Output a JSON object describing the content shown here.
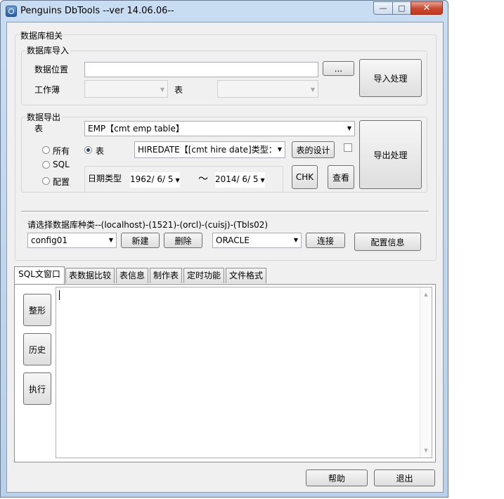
{
  "window": {
    "title": "Penguins DbTools --ver 14.06.06--",
    "min_glyph": "—",
    "max_glyph": "□",
    "close_glyph": "✕"
  },
  "db_section": {
    "title": "数据库相关",
    "import": {
      "title": "数据库导入",
      "location_label": "数据位置",
      "location_value": "",
      "browse_label": "...",
      "workbook_label": "工作薄",
      "workbook_value": "",
      "table_label": "表",
      "table_value": "",
      "import_button": "导入处理"
    },
    "export": {
      "title": "数据导出",
      "table_label": "表",
      "table_value": "EMP【cmt emp table】",
      "radio_all": "所有",
      "radio_table": "表",
      "radio_sql": "SQL",
      "radio_config": "配置",
      "column_value": "HIREDATE【[cmt hire date]类型：",
      "table_design_button": "表的设计",
      "date_type_label": "日期类型",
      "date_from": "1962/  6/  5",
      "tilde": "～",
      "date_to": "2014/  6/  5",
      "chk_button": "CHK",
      "view_button": "查看",
      "export_button": "导出处理"
    },
    "connection": {
      "label": "请选择数据库种类--(localhost)-(1521)-(orcl)-(cuisj)-(Tbls02)",
      "config_value": "config01",
      "new_button": "新建",
      "delete_button": "删除",
      "db_type_value": "ORACLE",
      "connect_button": "连接",
      "config_info_button": "配置信息"
    }
  },
  "tabs": [
    {
      "label": "SQL文窗口"
    },
    {
      "label": "表数据比较"
    },
    {
      "label": "表信息"
    },
    {
      "label": "制作表"
    },
    {
      "label": "定时功能"
    },
    {
      "label": "文件格式"
    }
  ],
  "sql_panel": {
    "format_button": "整形",
    "history_button": "历史",
    "execute_button": "执行",
    "editor_value": ""
  },
  "footer": {
    "help_button": "帮助",
    "exit_button": "退出"
  }
}
